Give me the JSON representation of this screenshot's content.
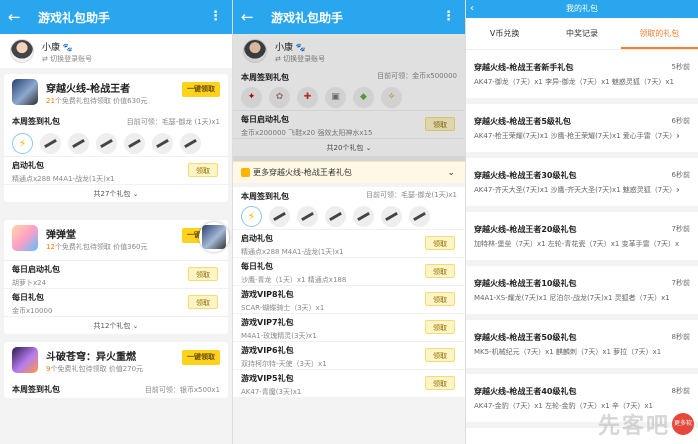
{
  "app": {
    "title": "游戏礼包助手"
  },
  "user": {
    "name": "小康",
    "switch_label": "切换登录账号"
  },
  "panel1": {
    "games": [
      {
        "name": "穿越火线-枪战王者",
        "count": "21",
        "sub": "个免费礼包待领取 价值630元",
        "one_key": "一键领取",
        "checkin_title": "本周签到礼包",
        "checkin_avail": "目前可领：毛瑟-御龙 (1天)x1",
        "gifts": [
          {
            "title": "启动礼包",
            "desc": "精通点x288 M4A1-战龙(1天)x1",
            "claim": "领取"
          }
        ],
        "total": "共27个礼包"
      },
      {
        "name": "弹弹堂",
        "count": "12",
        "sub": "个免费礼包待领取 价值360元",
        "one_key": "一键领取",
        "gifts": [
          {
            "title": "每日启动礼包",
            "desc": "胡萝卜x24",
            "claim": "领取"
          },
          {
            "title": "每日礼包",
            "desc": "金币x10000",
            "claim": "领取"
          }
        ],
        "total": "共12个礼包"
      },
      {
        "name": "斗破苍穹：异火重燃",
        "count": "9",
        "sub": "个免费礼包待领取 价值270元",
        "one_key": "一键领取",
        "checkin_title": "本周签到礼包",
        "checkin_avail": "目前可领：银币x500x1"
      }
    ]
  },
  "panel2": {
    "top_title": "本周签到礼包",
    "top_avail": "目前可领：金币x500000",
    "daily": {
      "title": "每日启动礼包",
      "desc": "金币x200000 飞鞋x20 强效太阳神水x15",
      "claim": "领取"
    },
    "top_total": "共20个礼包",
    "more_label": "更多穿越火线-枪战王者礼包",
    "checkin_title": "本周签到礼包",
    "checkin_avail": "目前可领：毛瑟-御龙(1天)x1",
    "gifts": [
      {
        "title": "启动礼包",
        "desc": "精通点x288 M4A1-战龙(1天)x1",
        "claim": "领取"
      },
      {
        "title": "每日礼包",
        "desc": "沙鹰-青龙（1天）x1 精通点x188",
        "claim": "领取"
      },
      {
        "title": "游戏VIP8礼包",
        "desc": "SCAR-蝴蝶骑士（3天）x1",
        "claim": "领取"
      },
      {
        "title": "游戏VIP7礼包",
        "desc": "M4A1-玫瑰精灵(3天)x1",
        "claim": "领取"
      },
      {
        "title": "游戏VIP6礼包",
        "desc": "双持柯尔特-天使（3天）x1",
        "claim": "领取"
      },
      {
        "title": "游戏VIP5礼包",
        "desc": "AK47-青魔(3天)x1",
        "claim": "领取"
      }
    ]
  },
  "panel3": {
    "title": "我的礼包",
    "tabs": [
      {
        "label": "V币兑换",
        "active": false
      },
      {
        "label": "中奖记录",
        "active": false
      },
      {
        "label": "领取的礼包",
        "active": true
      }
    ],
    "records": [
      {
        "title": "穿越火线-枪战王者新手礼包",
        "time": "5秒前",
        "desc": "AK47-御龙（7天）x1 李异-御龙（7天）x1 魅惑灵狐（7天）x1"
      },
      {
        "title": "穿越火线-枪战王者5级礼包",
        "time": "6秒前",
        "desc": "AK47-枪王荣耀(7天)x1 沙鹰-枪王荣耀(7天)x1 爱心手雷（7天）x1"
      },
      {
        "title": "穿越火线-枪战王者30级礼包",
        "time": "6秒前",
        "desc": "AK47-齐天大圣(7天)x1 沙鹰-齐天大圣(7天)x1 魅惑灵狐（7天）x1"
      },
      {
        "title": "穿越火线-枪战王者20级礼包",
        "time": "7秒前",
        "desc": "加特林-堡垒（7天）x1 左轮-青花瓷（7天）x1 变革手雷（7天）x1"
      },
      {
        "title": "穿越火线-枪战王者10级礼包",
        "time": "7秒前",
        "desc": "M4A1-XS-耀龙(7天)x1 尼泊尔-战龙(7天)x1 灵狐者（7天）x1"
      },
      {
        "title": "穿越火线-枪战王者50级礼包",
        "time": "8秒前",
        "desc": "MK5-机械纪元（7天）x1 麒麟刺（7天）x1 萝拉（7天）x1"
      },
      {
        "title": "穿越火线-枪战王者40级礼包",
        "time": "8秒前",
        "desc": "AK47-金豹（7天）x1 左轮-金豹（7天）x1 辛（7天）x1"
      }
    ]
  },
  "watermark": {
    "text": "先客吧",
    "badge": "更多软件"
  },
  "colors": {
    "primary": "#2aa6ee",
    "accent": "#ff7a2a",
    "button": "#ffd21c"
  }
}
